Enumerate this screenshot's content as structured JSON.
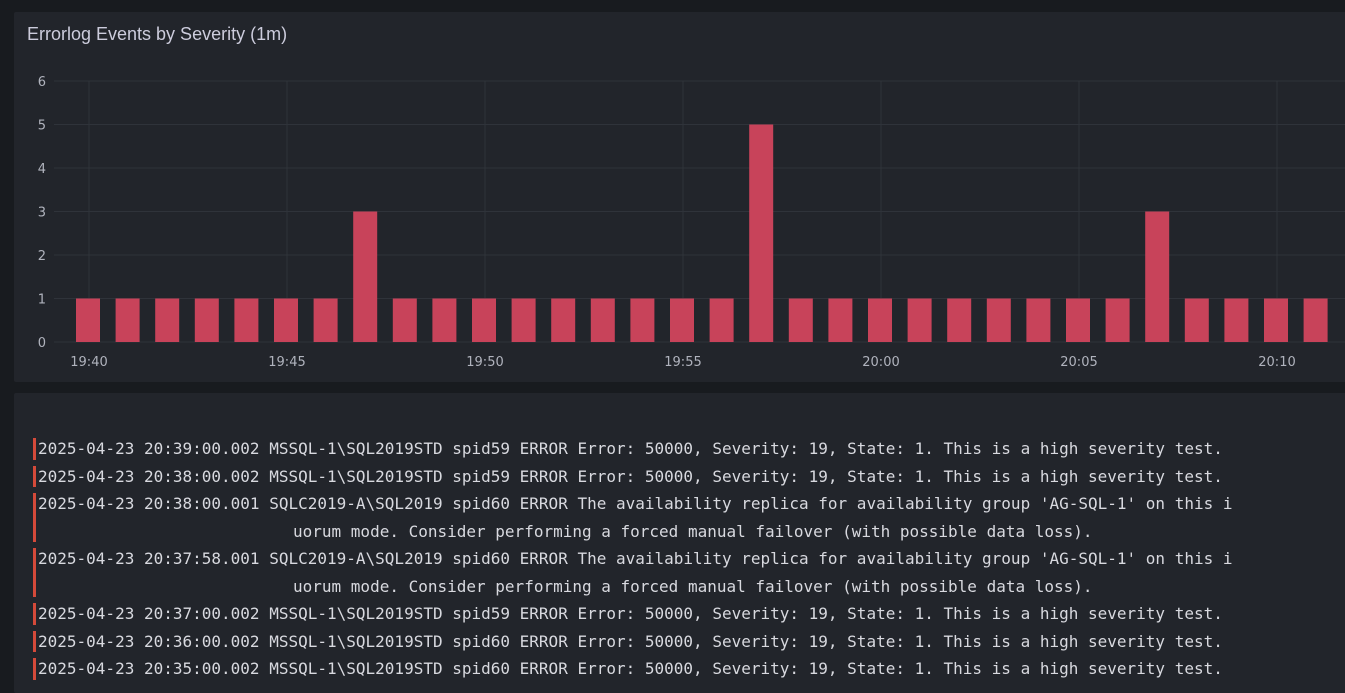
{
  "chart_panel": {
    "title": "Errorlog Events by Severity (1m)"
  },
  "log_panel": {
    "rows": [
      {
        "ts": "2025-04-23 20:39:00.002",
        "text": "MSSQL-1\\SQL2019STD spid59 ERROR Error: 50000, Severity: 19, State: 1. This is a high severity test.",
        "cont": ""
      },
      {
        "ts": "2025-04-23 20:38:00.002",
        "text": "MSSQL-1\\SQL2019STD spid59 ERROR Error: 50000, Severity: 19, State: 1. This is a high severity test.",
        "cont": ""
      },
      {
        "ts": "2025-04-23 20:38:00.001",
        "text": "SQLC2019-A\\SQL2019 spid60 ERROR The availability replica for availability group 'AG-SQL-1' on this i",
        "cont": "uorum mode. Consider performing a forced manual failover (with possible data loss)."
      },
      {
        "ts": "2025-04-23 20:37:58.001",
        "text": "SQLC2019-A\\SQL2019 spid60 ERROR The availability replica for availability group 'AG-SQL-1' on this i",
        "cont": "uorum mode. Consider performing a forced manual failover (with possible data loss)."
      },
      {
        "ts": "2025-04-23 20:37:00.002",
        "text": "MSSQL-1\\SQL2019STD spid59 ERROR Error: 50000, Severity: 19, State: 1. This is a high severity test.",
        "cont": ""
      },
      {
        "ts": "2025-04-23 20:36:00.002",
        "text": "MSSQL-1\\SQL2019STD spid60 ERROR Error: 50000, Severity: 19, State: 1. This is a high severity test.",
        "cont": ""
      },
      {
        "ts": "2025-04-23 20:35:00.002",
        "text": "MSSQL-1\\SQL2019STD spid60 ERROR Error: 50000, Severity: 19, State: 1. This is a high severity test.",
        "cont": ""
      }
    ]
  },
  "colors": {
    "background": "#181b1f",
    "panel": "#22252b",
    "bar": "#c8435a",
    "log_marker": "#d44a3a"
  },
  "chart_data": {
    "type": "bar",
    "title": "Errorlog Events by Severity (1m)",
    "x_ticks": [
      "19:40",
      "19:45",
      "19:50",
      "19:55",
      "20:00",
      "20:05",
      "20:10"
    ],
    "y_ticks": [
      "0",
      "1",
      "2",
      "3",
      "4",
      "5",
      "6"
    ],
    "ylim": [
      0,
      6
    ],
    "grid": true,
    "categories": [
      "19:40",
      "19:41",
      "19:42",
      "19:43",
      "19:44",
      "19:45",
      "19:46",
      "19:47",
      "19:48",
      "19:49",
      "19:50",
      "19:51",
      "19:52",
      "19:53",
      "19:54",
      "19:55",
      "19:56",
      "19:57",
      "19:58",
      "19:59",
      "20:00",
      "20:01",
      "20:02",
      "20:03",
      "20:04",
      "20:05",
      "20:06",
      "20:07",
      "20:08",
      "20:09",
      "20:10",
      "20:11"
    ],
    "values": [
      1,
      1,
      1,
      1,
      1,
      1,
      1,
      3,
      1,
      1,
      1,
      1,
      1,
      1,
      1,
      1,
      1,
      5,
      1,
      1,
      1,
      1,
      1,
      1,
      1,
      1,
      1,
      3,
      1,
      1,
      1,
      1
    ]
  }
}
